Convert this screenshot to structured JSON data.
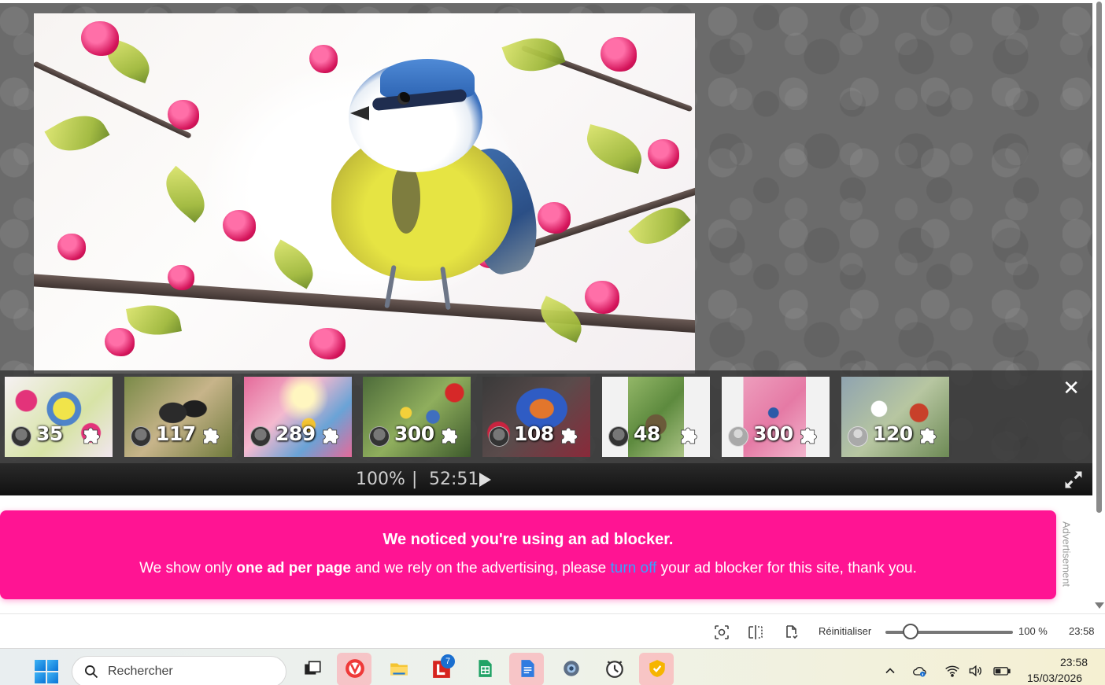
{
  "thumbnails": [
    {
      "count": "35",
      "avatar": "photo"
    },
    {
      "count": "117",
      "avatar": "photo"
    },
    {
      "count": "289",
      "avatar": "photo"
    },
    {
      "count": "300",
      "avatar": "photo"
    },
    {
      "count": "108",
      "avatar": "photo"
    },
    {
      "count": "48",
      "avatar": "photo"
    },
    {
      "count": "300",
      "avatar": "default"
    },
    {
      "count": "120",
      "avatar": "default"
    }
  ],
  "status": {
    "progress": "100%",
    "separator": "|",
    "timer": "52:51"
  },
  "adblock": {
    "title": "We noticed you're using an ad blocker.",
    "msg_part1": "We show only ",
    "msg_bold": "one ad per page",
    "msg_part2": " and we rely on the advertising, please ",
    "msg_link": "turn off",
    "msg_part3": " your ad blocker for this site, thank you.",
    "ad_label": "Advertisement"
  },
  "browser_bar": {
    "reset_label": "Réinitialiser",
    "zoom_value": "100 %",
    "zoom_fraction": 0.2,
    "time": "23:58"
  },
  "taskbar": {
    "search_placeholder": "Rechercher",
    "apps": [
      "taskview-icon",
      "vivaldi-icon",
      "file-explorer-icon",
      "l-app-icon",
      "sheets-icon",
      "docs-icon",
      "settings-icon",
      "clock-app-icon",
      "shield-app-icon"
    ],
    "l_app_badge": "7",
    "clock_time": "23:58",
    "clock_date": "15/03/2026"
  },
  "colors": {
    "banner": "#ff1493",
    "link": "#3aa0ff",
    "stage": "#6b6b6b"
  }
}
